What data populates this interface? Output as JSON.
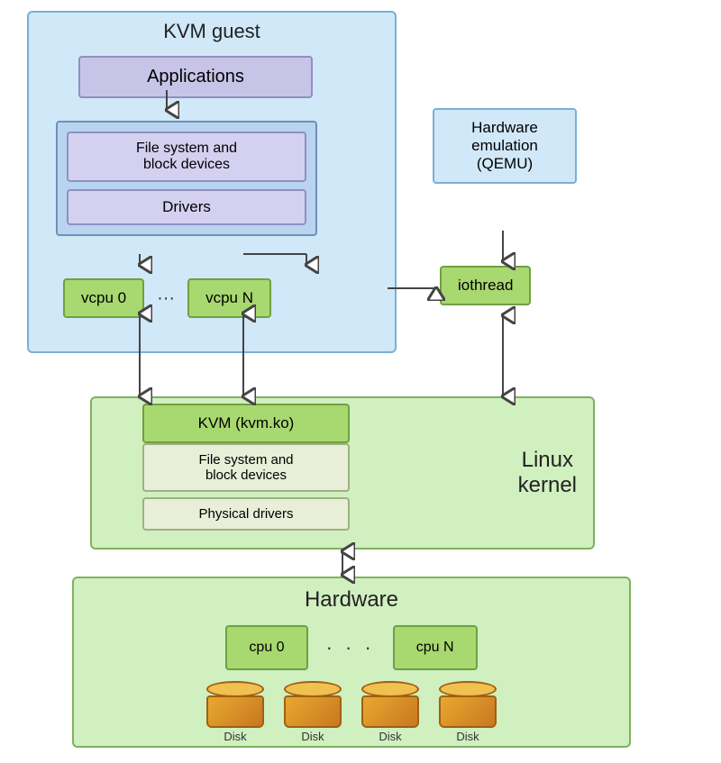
{
  "kvm_guest": {
    "title": "KVM guest",
    "applications": "Applications",
    "fs_block": "File system and\nblock devices",
    "drivers": "Drivers",
    "vcpu0": "vcpu 0",
    "vcpu_dots": "···",
    "vcpuN": "vcpu N"
  },
  "hw_emulation": {
    "label": "Hardware\nemulation\n(QEMU)"
  },
  "iothread": {
    "label": "iothread"
  },
  "linux_kernel": {
    "title": "Linux\nkernel",
    "kvm_ko": "KVM (kvm.ko)",
    "fs_block": "File system and\nblock devices",
    "phys_drivers": "Physical drivers"
  },
  "hardware": {
    "title": "Hardware",
    "cpu0": "cpu 0",
    "cpu_dots": "· · ·",
    "cpuN": "cpu N",
    "disk_label": "Disk"
  }
}
